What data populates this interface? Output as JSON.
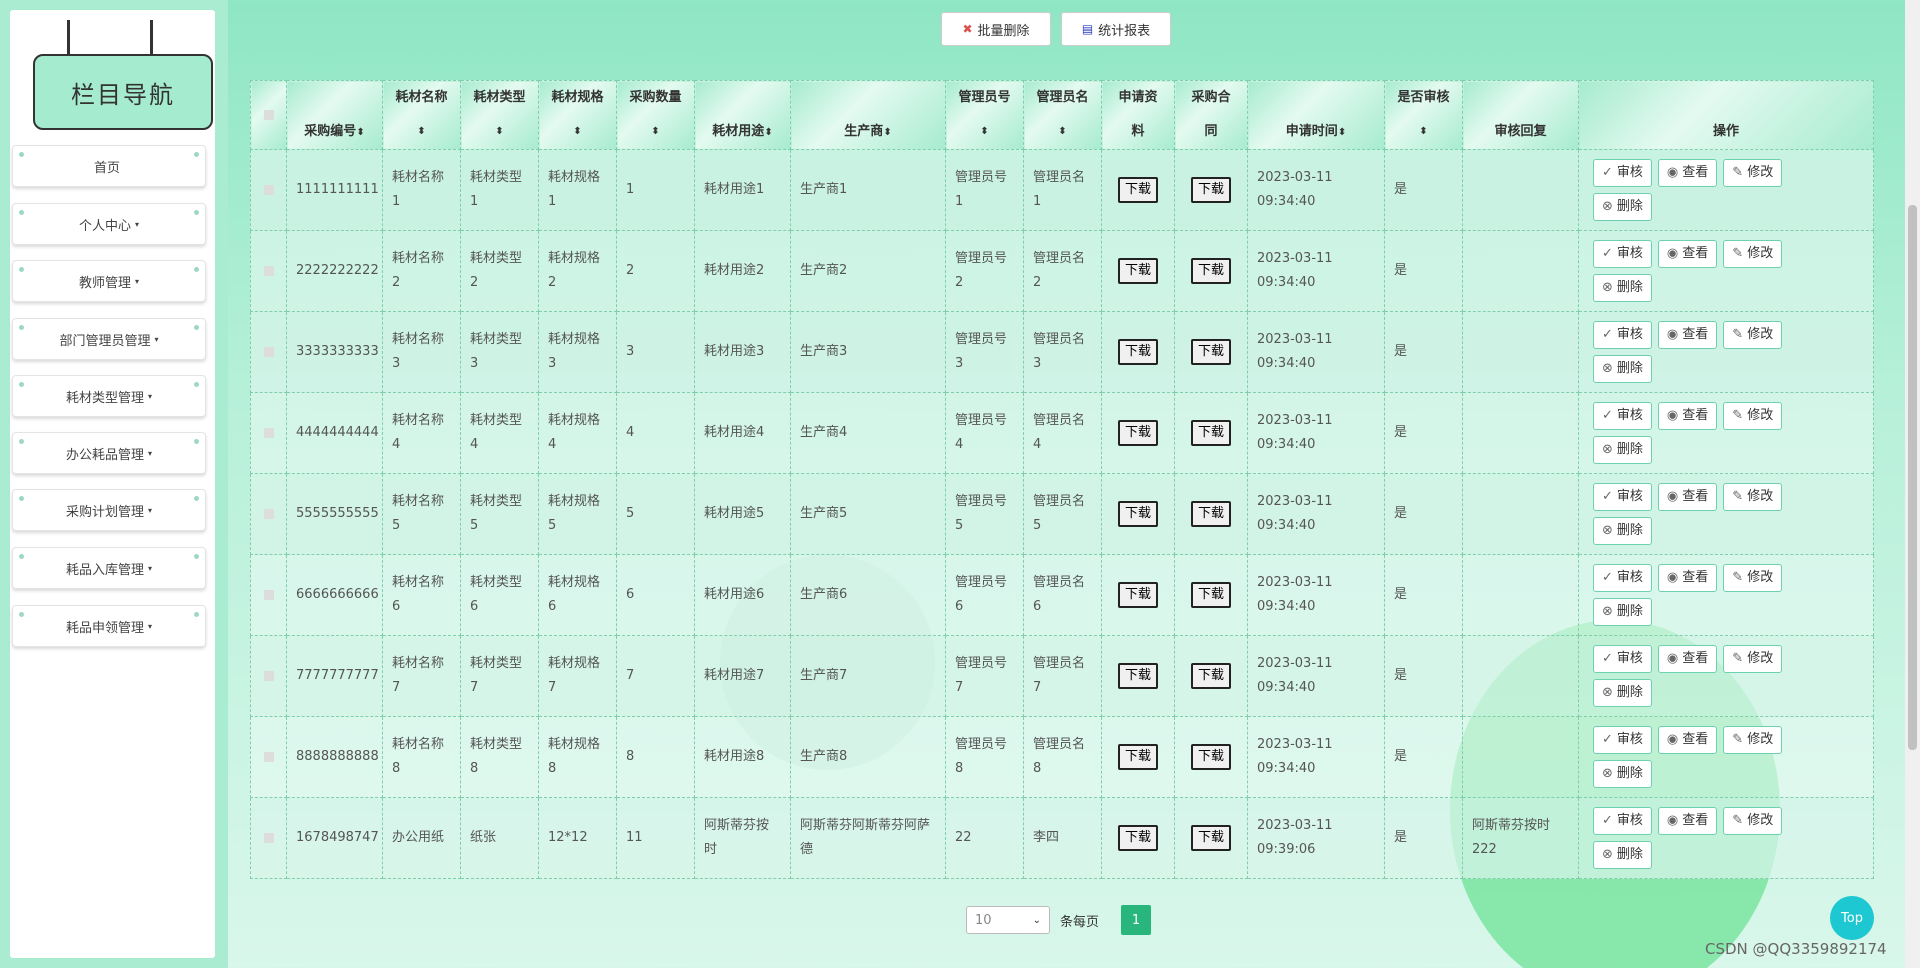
{
  "sidebar": {
    "title": "栏目导航",
    "items": [
      {
        "label": "首页",
        "caret": ""
      },
      {
        "label": "个人中心",
        "caret": "▾"
      },
      {
        "label": "教师管理",
        "caret": "▾"
      },
      {
        "label": "部门管理员管理",
        "caret": "▾"
      },
      {
        "label": "耗材类型管理",
        "caret": "▾"
      },
      {
        "label": "办公耗品管理",
        "caret": "▾"
      },
      {
        "label": "采购计划管理",
        "caret": "▾"
      },
      {
        "label": "耗品入库管理",
        "caret": "▾"
      },
      {
        "label": "耗品申领管理",
        "caret": "▾"
      }
    ]
  },
  "toolbar": {
    "batch_delete_label": "批量删除",
    "report_label": "统计报表",
    "batch_delete_icon": "✖",
    "report_icon": "🗄"
  },
  "table": {
    "headers": [
      "采购编号",
      "耗材名称",
      "耗材类型",
      "耗材规格",
      "采购数量",
      "耗材用途",
      "生产商",
      "管理员号",
      "管理员名",
      "申请资料",
      "采购合同",
      "申请时间",
      "是否审核",
      "审核回复",
      "操作"
    ],
    "sort_icon": "⬍",
    "download_label": "下载",
    "actions": {
      "audit": "审核",
      "view": "查看",
      "edit": "修改",
      "delete": "删除"
    },
    "rows": [
      {
        "id": "1111111111",
        "name": "耗材名称1",
        "type": "耗材类型1",
        "spec": "耗材规格1",
        "qty": "1",
        "use": "耗材用途1",
        "maker": "生产商1",
        "admin_no": "管理员号1",
        "admin_name": "管理员名1",
        "date": "2023-03-11",
        "time": "09:34:40",
        "audited": "是",
        "reply": ""
      },
      {
        "id": "2222222222",
        "name": "耗材名称2",
        "type": "耗材类型2",
        "spec": "耗材规格2",
        "qty": "2",
        "use": "耗材用途2",
        "maker": "生产商2",
        "admin_no": "管理员号2",
        "admin_name": "管理员名2",
        "date": "2023-03-11",
        "time": "09:34:40",
        "audited": "是",
        "reply": ""
      },
      {
        "id": "3333333333",
        "name": "耗材名称3",
        "type": "耗材类型3",
        "spec": "耗材规格3",
        "qty": "3",
        "use": "耗材用途3",
        "maker": "生产商3",
        "admin_no": "管理员号3",
        "admin_name": "管理员名3",
        "date": "2023-03-11",
        "time": "09:34:40",
        "audited": "是",
        "reply": ""
      },
      {
        "id": "4444444444",
        "name": "耗材名称4",
        "type": "耗材类型4",
        "spec": "耗材规格4",
        "qty": "4",
        "use": "耗材用途4",
        "maker": "生产商4",
        "admin_no": "管理员号4",
        "admin_name": "管理员名4",
        "date": "2023-03-11",
        "time": "09:34:40",
        "audited": "是",
        "reply": ""
      },
      {
        "id": "5555555555",
        "name": "耗材名称5",
        "type": "耗材类型5",
        "spec": "耗材规格5",
        "qty": "5",
        "use": "耗材用途5",
        "maker": "生产商5",
        "admin_no": "管理员号5",
        "admin_name": "管理员名5",
        "date": "2023-03-11",
        "time": "09:34:40",
        "audited": "是",
        "reply": ""
      },
      {
        "id": "6666666666",
        "name": "耗材名称6",
        "type": "耗材类型6",
        "spec": "耗材规格6",
        "qty": "6",
        "use": "耗材用途6",
        "maker": "生产商6",
        "admin_no": "管理员号6",
        "admin_name": "管理员名6",
        "date": "2023-03-11",
        "time": "09:34:40",
        "audited": "是",
        "reply": ""
      },
      {
        "id": "7777777777",
        "name": "耗材名称7",
        "type": "耗材类型7",
        "spec": "耗材规格7",
        "qty": "7",
        "use": "耗材用途7",
        "maker": "生产商7",
        "admin_no": "管理员号7",
        "admin_name": "管理员名7",
        "date": "2023-03-11",
        "time": "09:34:40",
        "audited": "是",
        "reply": ""
      },
      {
        "id": "8888888888",
        "name": "耗材名称8",
        "type": "耗材类型8",
        "spec": "耗材规格8",
        "qty": "8",
        "use": "耗材用途8",
        "maker": "生产商8",
        "admin_no": "管理员号8",
        "admin_name": "管理员名8",
        "date": "2023-03-11",
        "time": "09:34:40",
        "audited": "是",
        "reply": ""
      },
      {
        "id": "1678498747",
        "name": "办公用纸",
        "type": "纸张",
        "spec": "12*12",
        "qty": "11",
        "use": "阿斯蒂芬按时",
        "maker": "阿斯蒂芬阿斯蒂芬阿萨德",
        "admin_no": "22",
        "admin_name": "李四",
        "date": "2023-03-11",
        "time": "09:39:06",
        "audited": "是",
        "reply": "阿斯蒂芬按时222"
      }
    ]
  },
  "pagination": {
    "page_size": "10",
    "per_page_label": "条每页",
    "current_page": "1"
  },
  "top_button_label": "Top",
  "watermark": "CSDN @QQ3359892174"
}
